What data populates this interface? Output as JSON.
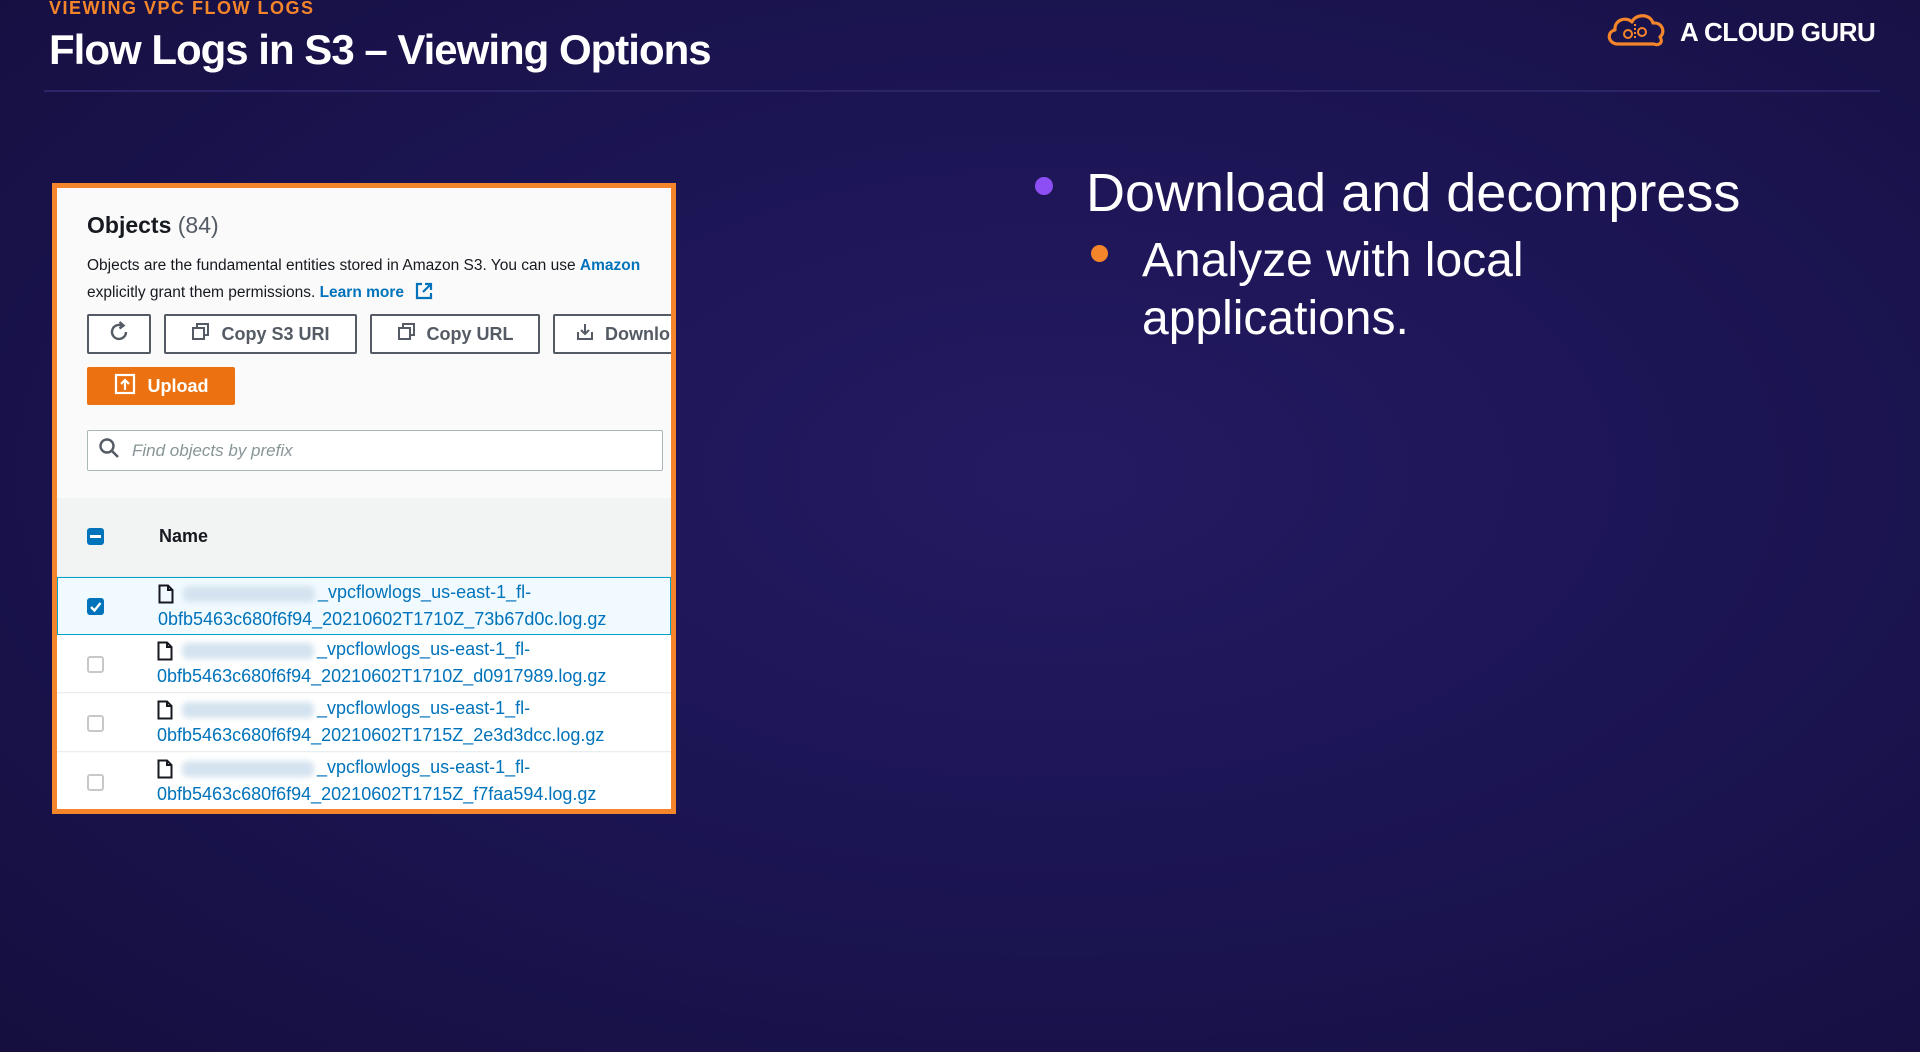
{
  "header": {
    "section_label": "VIEWING VPC FLOW LOGS",
    "title": "Flow Logs in S3 – Viewing Options",
    "logo_text": "A CLOUD GURU",
    "logo_icon": "cloud-logo-icon"
  },
  "s3_panel": {
    "heading": "Objects",
    "count": "(84)",
    "description_line1": "Objects are the fundamental entities stored in Amazon S3. You can use",
    "description_line1_link": "Amazon",
    "description_line2": "explicitly grant them permissions.",
    "learn_more": "Learn more",
    "buttons": {
      "refresh_icon": "refresh-icon",
      "copy_s3_uri": "Copy S3 URI",
      "copy_url": "Copy URL",
      "download": "Downlo",
      "upload": "Upload"
    },
    "search": {
      "placeholder": "Find objects by prefix"
    },
    "table": {
      "column_name": "Name",
      "rows": [
        {
          "line1": "_vpcflowlogs_us-east-1_fl-",
          "line2": "0bfb5463c680f6f94_20210602T1710Z_73b67d0c.log.gz",
          "selected": true
        },
        {
          "line1": "_vpcflowlogs_us-east-1_fl-",
          "line2": "0bfb5463c680f6f94_20210602T1710Z_d0917989.log.gz",
          "selected": false
        },
        {
          "line1": "_vpcflowlogs_us-east-1_fl-",
          "line2": "0bfb5463c680f6f94_20210602T1715Z_2e3d3dcc.log.gz",
          "selected": false
        },
        {
          "line1": "_vpcflowlogs_us-east-1_fl-",
          "line2": "0bfb5463c680f6f94_20210602T1715Z_f7faa594.log.gz",
          "selected": false
        }
      ]
    }
  },
  "bullets": {
    "main": "Download and decompress",
    "sub": "Analyze with local applications."
  },
  "colors": {
    "accent_orange": "#f5852a",
    "accent_purple": "#8d4ff5",
    "background": "#1c1554",
    "aws_link_blue": "#0073bb",
    "aws_upload_orange": "#ec7211"
  }
}
